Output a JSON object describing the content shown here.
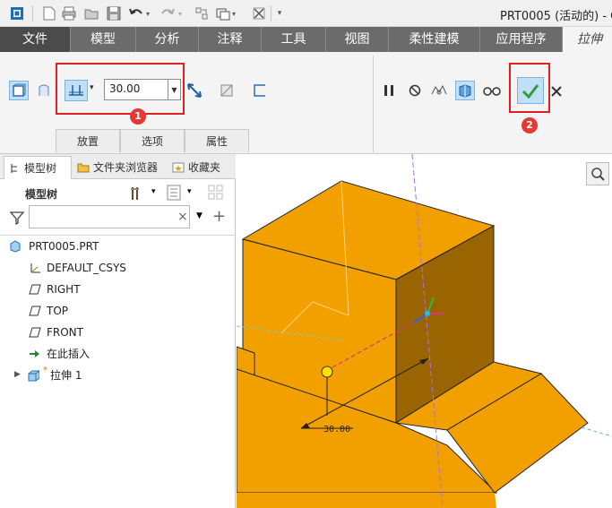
{
  "quick_access": {
    "title": "PRT0005 (活动的) - C"
  },
  "menu_tabs": [
    {
      "label": "文件"
    },
    {
      "label": "模型"
    },
    {
      "label": "分析"
    },
    {
      "label": "注释"
    },
    {
      "label": "工具"
    },
    {
      "label": "视图"
    },
    {
      "label": "柔性建模"
    },
    {
      "label": "应用程序"
    },
    {
      "label": "拉伸"
    }
  ],
  "ribbon": {
    "depth_value": "30.00",
    "subtabs": [
      {
        "label": "放置"
      },
      {
        "label": "选项"
      },
      {
        "label": "属性"
      }
    ],
    "callouts": [
      "1",
      "2"
    ]
  },
  "left_panel": {
    "nav_tabs": [
      {
        "label": "模型树"
      },
      {
        "label": "文件夹浏览器"
      },
      {
        "label": "收藏夹"
      }
    ],
    "tree_title": "模型树",
    "filter_clear": "×",
    "tree_items": [
      {
        "label": "PRT0005.PRT"
      },
      {
        "label": "DEFAULT_CSYS"
      },
      {
        "label": "RIGHT"
      },
      {
        "label": "TOP"
      },
      {
        "label": "FRONT"
      },
      {
        "label": "在此插入"
      },
      {
        "label": "拉伸 1",
        "marker": "*"
      }
    ]
  },
  "graphics": {
    "dimension_label": "30.00",
    "body_color": "#f2a000",
    "side_color": "#9a6400"
  },
  "colors": {
    "tab_bar": "#6b6b6b",
    "ribbon_bg": "#f4f4f4",
    "highlight": "#e02020",
    "confirm_green": "#2e9d3b"
  }
}
